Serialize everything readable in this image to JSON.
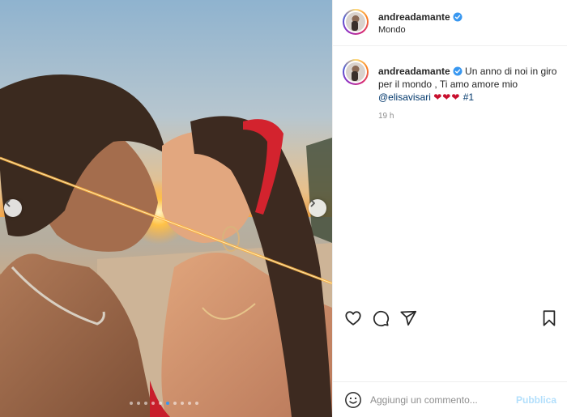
{
  "post": {
    "username": "andreadamante",
    "location": "Mondo",
    "caption_text": "Un anno di noi in giro per il mondo , Ti amo amore mio",
    "mention": "@elisavisari",
    "emojis": "❤❤❤",
    "hashtag": "#1",
    "time": "19 h",
    "slide_count": 10,
    "active_slide": 5
  },
  "comment_box": {
    "placeholder": "Aggiungi un commento...",
    "publish_label": "Pubblica"
  },
  "icons": {
    "verified": "verified-badge-icon",
    "like": "heart-icon",
    "comment": "comment-bubble-icon",
    "share": "paper-plane-icon",
    "save": "bookmark-icon",
    "emoji": "smiley-icon",
    "prev": "chevron-left-icon",
    "next": "chevron-right-icon"
  },
  "colors": {
    "accent": "#3897f0",
    "link": "#00376b",
    "publish_disabled": "#b2dffc",
    "muted": "#8e8e8e"
  }
}
